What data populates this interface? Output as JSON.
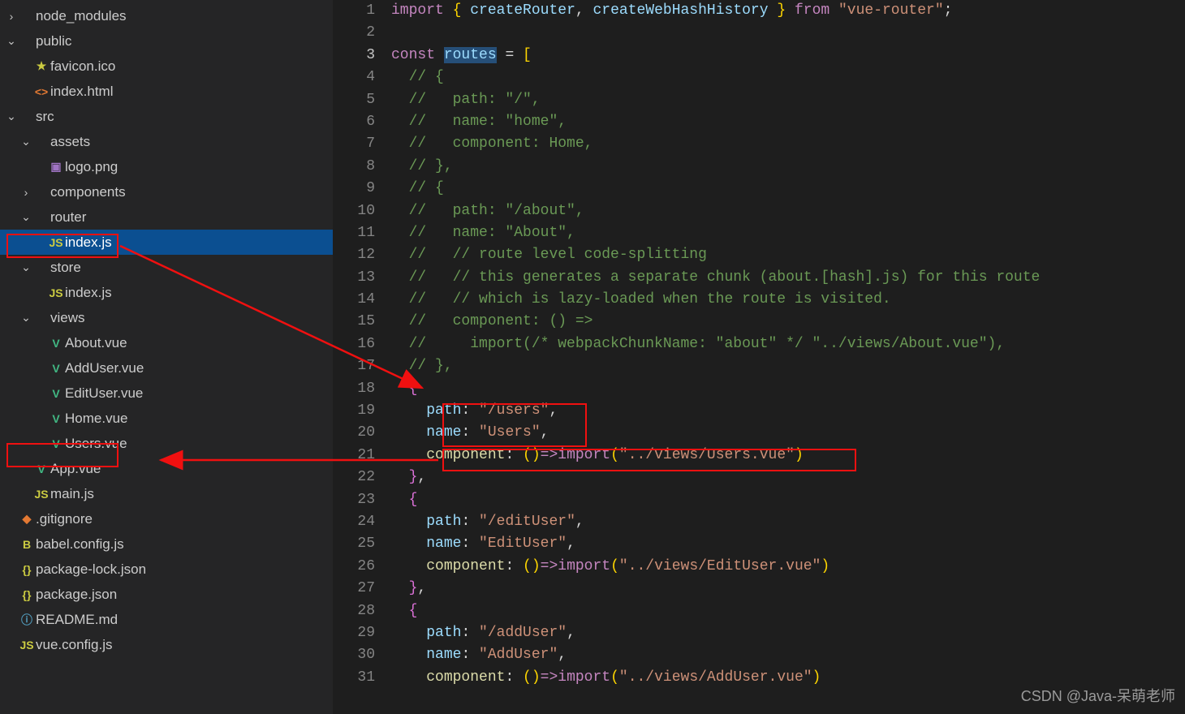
{
  "sidebar": {
    "items": [
      {
        "indent": 0,
        "chev": "closed",
        "icon": "",
        "iconClass": "",
        "label": "node_modules"
      },
      {
        "indent": 0,
        "chev": "open",
        "icon": "",
        "iconClass": "",
        "label": "public"
      },
      {
        "indent": 1,
        "chev": "none",
        "icon": "★",
        "iconClass": "star",
        "label": "favicon.ico"
      },
      {
        "indent": 1,
        "chev": "none",
        "icon": "<>",
        "iconClass": "html",
        "label": "index.html"
      },
      {
        "indent": 0,
        "chev": "open",
        "icon": "",
        "iconClass": "",
        "label": "src"
      },
      {
        "indent": 1,
        "chev": "open",
        "icon": "",
        "iconClass": "",
        "label": "assets"
      },
      {
        "indent": 2,
        "chev": "none",
        "icon": "▣",
        "iconClass": "img",
        "label": "logo.png"
      },
      {
        "indent": 1,
        "chev": "closed",
        "icon": "",
        "iconClass": "",
        "label": "components"
      },
      {
        "indent": 1,
        "chev": "open",
        "icon": "",
        "iconClass": "",
        "label": "router"
      },
      {
        "indent": 2,
        "chev": "none",
        "icon": "JS",
        "iconClass": "js",
        "label": "index.js",
        "selected": true
      },
      {
        "indent": 1,
        "chev": "open",
        "icon": "",
        "iconClass": "",
        "label": "store"
      },
      {
        "indent": 2,
        "chev": "none",
        "icon": "JS",
        "iconClass": "js",
        "label": "index.js"
      },
      {
        "indent": 1,
        "chev": "open",
        "icon": "",
        "iconClass": "",
        "label": "views"
      },
      {
        "indent": 2,
        "chev": "none",
        "icon": "V",
        "iconClass": "vue",
        "label": "About.vue"
      },
      {
        "indent": 2,
        "chev": "none",
        "icon": "V",
        "iconClass": "vue",
        "label": "AddUser.vue"
      },
      {
        "indent": 2,
        "chev": "none",
        "icon": "V",
        "iconClass": "vue",
        "label": "EditUser.vue"
      },
      {
        "indent": 2,
        "chev": "none",
        "icon": "V",
        "iconClass": "vue",
        "label": "Home.vue"
      },
      {
        "indent": 2,
        "chev": "none",
        "icon": "V",
        "iconClass": "vue",
        "label": "Users.vue"
      },
      {
        "indent": 1,
        "chev": "none",
        "icon": "V",
        "iconClass": "vue",
        "label": "App.vue"
      },
      {
        "indent": 1,
        "chev": "none",
        "icon": "JS",
        "iconClass": "js",
        "label": "main.js"
      },
      {
        "indent": 0,
        "chev": "none",
        "icon": "◆",
        "iconClass": "git",
        "label": ".gitignore"
      },
      {
        "indent": 0,
        "chev": "none",
        "icon": "B",
        "iconClass": "babel",
        "label": "babel.config.js"
      },
      {
        "indent": 0,
        "chev": "none",
        "icon": "{}",
        "iconClass": "brace",
        "label": "package-lock.json"
      },
      {
        "indent": 0,
        "chev": "none",
        "icon": "{}",
        "iconClass": "brace",
        "label": "package.json"
      },
      {
        "indent": 0,
        "chev": "none",
        "icon": "ⓘ",
        "iconClass": "info",
        "label": "README.md"
      },
      {
        "indent": 0,
        "chev": "none",
        "icon": "JS",
        "iconClass": "js",
        "label": "vue.config.js"
      }
    ]
  },
  "editor": {
    "currentLine": 3,
    "lines": [
      {
        "n": 1,
        "tokens": [
          [
            "kw",
            "import"
          ],
          [
            "punc",
            " "
          ],
          [
            "brkt",
            "{"
          ],
          [
            "punc",
            " "
          ],
          [
            "id",
            "createRouter"
          ],
          [
            "punc",
            ", "
          ],
          [
            "id",
            "createWebHashHistory"
          ],
          [
            "punc",
            " "
          ],
          [
            "brkt",
            "}"
          ],
          [
            "punc",
            " "
          ],
          [
            "kw",
            "from"
          ],
          [
            "punc",
            " "
          ],
          [
            "str",
            "\"vue-router\""
          ],
          [
            "punc",
            ";"
          ]
        ]
      },
      {
        "n": 2,
        "tokens": []
      },
      {
        "n": 3,
        "tokens": [
          [
            "kw",
            "const"
          ],
          [
            "punc",
            " "
          ],
          [
            "id",
            "routes",
            "sel"
          ],
          [
            "punc",
            " = "
          ],
          [
            "brkt",
            "["
          ]
        ]
      },
      {
        "n": 4,
        "tokens": [
          [
            "punc",
            "  "
          ],
          [
            "cmt",
            "// {"
          ]
        ]
      },
      {
        "n": 5,
        "tokens": [
          [
            "punc",
            "  "
          ],
          [
            "cmt",
            "//   path: \"/\","
          ]
        ]
      },
      {
        "n": 6,
        "tokens": [
          [
            "punc",
            "  "
          ],
          [
            "cmt",
            "//   name: \"home\","
          ]
        ]
      },
      {
        "n": 7,
        "tokens": [
          [
            "punc",
            "  "
          ],
          [
            "cmt",
            "//   component: Home,"
          ]
        ]
      },
      {
        "n": 8,
        "tokens": [
          [
            "punc",
            "  "
          ],
          [
            "cmt",
            "// },"
          ]
        ]
      },
      {
        "n": 9,
        "tokens": [
          [
            "punc",
            "  "
          ],
          [
            "cmt",
            "// {"
          ]
        ]
      },
      {
        "n": 10,
        "tokens": [
          [
            "punc",
            "  "
          ],
          [
            "cmt",
            "//   path: \"/about\","
          ]
        ]
      },
      {
        "n": 11,
        "tokens": [
          [
            "punc",
            "  "
          ],
          [
            "cmt",
            "//   name: \"About\","
          ]
        ]
      },
      {
        "n": 12,
        "tokens": [
          [
            "punc",
            "  "
          ],
          [
            "cmt",
            "//   // route level code-splitting"
          ]
        ]
      },
      {
        "n": 13,
        "tokens": [
          [
            "punc",
            "  "
          ],
          [
            "cmt",
            "//   // this generates a separate chunk (about.[hash].js) for this route"
          ]
        ]
      },
      {
        "n": 14,
        "tokens": [
          [
            "punc",
            "  "
          ],
          [
            "cmt",
            "//   // which is lazy-loaded when the route is visited."
          ]
        ]
      },
      {
        "n": 15,
        "tokens": [
          [
            "punc",
            "  "
          ],
          [
            "cmt",
            "//   component: () =>"
          ]
        ]
      },
      {
        "n": 16,
        "tokens": [
          [
            "punc",
            "  "
          ],
          [
            "cmt",
            "//     import(/* webpackChunkName: \"about\" */ \"../views/About.vue\"),"
          ]
        ]
      },
      {
        "n": 17,
        "tokens": [
          [
            "punc",
            "  "
          ],
          [
            "cmt",
            "// },"
          ]
        ]
      },
      {
        "n": 18,
        "tokens": [
          [
            "punc",
            "  "
          ],
          [
            "brkt2",
            "{"
          ]
        ]
      },
      {
        "n": 19,
        "tokens": [
          [
            "punc",
            "    "
          ],
          [
            "id",
            "path"
          ],
          [
            "punc",
            ": "
          ],
          [
            "str",
            "\"/users\""
          ],
          [
            "punc",
            ","
          ]
        ]
      },
      {
        "n": 20,
        "tokens": [
          [
            "punc",
            "    "
          ],
          [
            "id",
            "name"
          ],
          [
            "punc",
            ": "
          ],
          [
            "str",
            "\"Users\""
          ],
          [
            "punc",
            ","
          ]
        ]
      },
      {
        "n": 21,
        "tokens": [
          [
            "punc",
            "    "
          ],
          [
            "fn",
            "component"
          ],
          [
            "punc",
            ": "
          ],
          [
            "brkt",
            "("
          ],
          [
            "brkt",
            ")"
          ],
          [
            "kw",
            "=>"
          ],
          [
            "kw",
            "import"
          ],
          [
            "brkt",
            "("
          ],
          [
            "str",
            "\"../views/Users.vue\""
          ],
          [
            "brkt",
            ")"
          ]
        ]
      },
      {
        "n": 22,
        "tokens": [
          [
            "punc",
            "  "
          ],
          [
            "brkt2",
            "}"
          ],
          [
            "punc",
            ","
          ]
        ]
      },
      {
        "n": 23,
        "tokens": [
          [
            "punc",
            "  "
          ],
          [
            "brkt2",
            "{"
          ]
        ]
      },
      {
        "n": 24,
        "tokens": [
          [
            "punc",
            "    "
          ],
          [
            "id",
            "path"
          ],
          [
            "punc",
            ": "
          ],
          [
            "str",
            "\"/editUser\""
          ],
          [
            "punc",
            ","
          ]
        ]
      },
      {
        "n": 25,
        "tokens": [
          [
            "punc",
            "    "
          ],
          [
            "id",
            "name"
          ],
          [
            "punc",
            ": "
          ],
          [
            "str",
            "\"EditUser\""
          ],
          [
            "punc",
            ","
          ]
        ]
      },
      {
        "n": 26,
        "tokens": [
          [
            "punc",
            "    "
          ],
          [
            "fn",
            "component"
          ],
          [
            "punc",
            ": "
          ],
          [
            "brkt",
            "("
          ],
          [
            "brkt",
            ")"
          ],
          [
            "kw",
            "=>"
          ],
          [
            "kw",
            "import"
          ],
          [
            "brkt",
            "("
          ],
          [
            "str",
            "\"../views/EditUser.vue\""
          ],
          [
            "brkt",
            ")"
          ]
        ]
      },
      {
        "n": 27,
        "tokens": [
          [
            "punc",
            "  "
          ],
          [
            "brkt2",
            "}"
          ],
          [
            "punc",
            ","
          ]
        ]
      },
      {
        "n": 28,
        "tokens": [
          [
            "punc",
            "  "
          ],
          [
            "brkt2",
            "{"
          ]
        ]
      },
      {
        "n": 29,
        "tokens": [
          [
            "punc",
            "    "
          ],
          [
            "id",
            "path"
          ],
          [
            "punc",
            ": "
          ],
          [
            "str",
            "\"/addUser\""
          ],
          [
            "punc",
            ","
          ]
        ]
      },
      {
        "n": 30,
        "tokens": [
          [
            "punc",
            "    "
          ],
          [
            "id",
            "name"
          ],
          [
            "punc",
            ": "
          ],
          [
            "str",
            "\"AddUser\""
          ],
          [
            "punc",
            ","
          ]
        ]
      },
      {
        "n": 31,
        "tokens": [
          [
            "punc",
            "    "
          ],
          [
            "fn",
            "component"
          ],
          [
            "punc",
            ": "
          ],
          [
            "brkt",
            "("
          ],
          [
            "brkt",
            ")"
          ],
          [
            "kw",
            "=>"
          ],
          [
            "kw",
            "import"
          ],
          [
            "brkt",
            "("
          ],
          [
            "str",
            "\"../views/AddUser.vue\""
          ],
          [
            "brkt",
            ")"
          ]
        ]
      }
    ]
  },
  "watermark": "CSDN @Java-呆萌老师"
}
